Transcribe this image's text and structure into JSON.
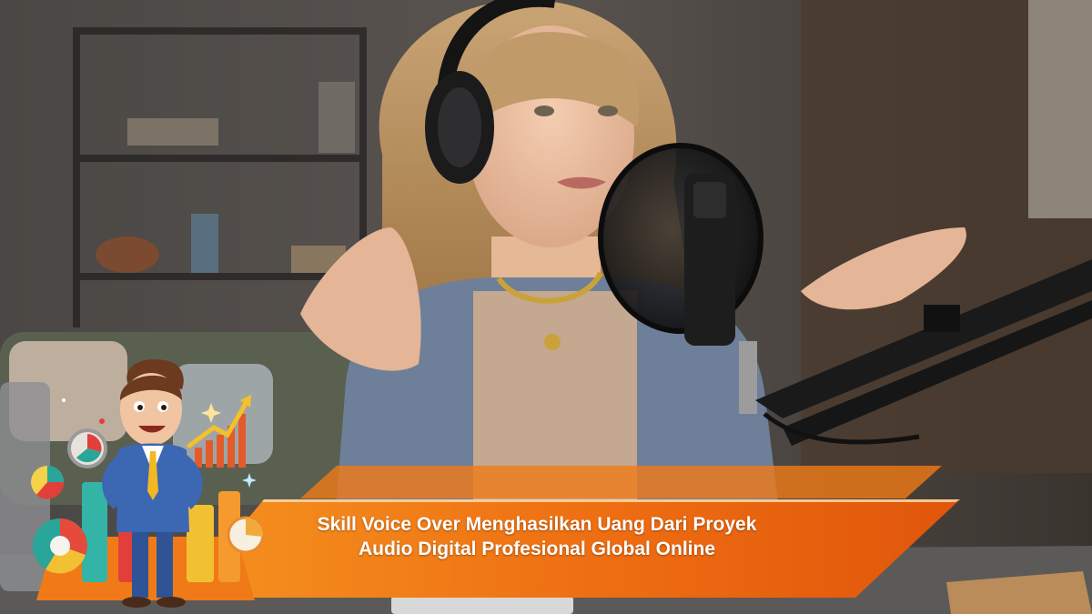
{
  "banner": {
    "line1": "Skill Voice Over Menghasilkan Uang Dari Proyek",
    "line2": "Audio Digital Profesional Global Online"
  },
  "colors": {
    "banner_orange": "#f07a17",
    "banner_dark": "#d85a0a",
    "suit_blue": "#3b67b3",
    "tie_yellow": "#f2b822"
  },
  "icons": {
    "mascot": "businessman-cartoon-icon",
    "growth_chart": "bar-chart-arrow-icon",
    "pie": "pie-chart-icon"
  }
}
